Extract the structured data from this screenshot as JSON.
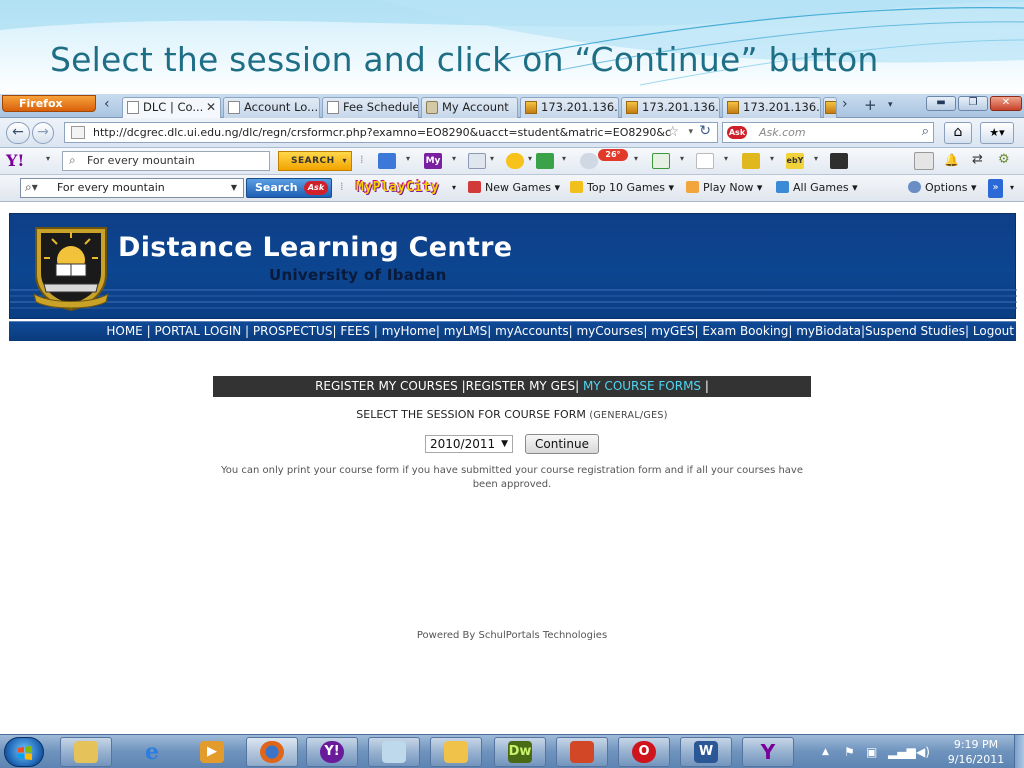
{
  "slide": {
    "title": "Select the session and click on “Continue” button"
  },
  "browser": {
    "app_button": "Firefox",
    "tabs": [
      {
        "label": "DLC | Co...",
        "active": true
      },
      {
        "label": "Account Lo...",
        "active": false
      },
      {
        "label": "Fee Schedule",
        "active": false
      },
      {
        "label": "My Account",
        "active": false
      },
      {
        "label": "173.201.136....",
        "active": false
      },
      {
        "label": "173.201.136....",
        "active": false
      },
      {
        "label": "173.201.136....",
        "active": false
      }
    ],
    "url": "http://dcgrec.dlc.ui.edu.ng/dlc/regn/crsformcr.php?examno=EO8290&uacct=student&matric=EO8290&c",
    "ask_placeholder": "Ask.com",
    "ask_logo": "Ask"
  },
  "yahoo_toolbar": {
    "logo": "Y!",
    "search_value": "For every mountain",
    "search_button": "SEARCH",
    "weather_temp": "26°"
  },
  "ask_toolbar": {
    "search_value": "For every mountain",
    "search_button": "Search",
    "mpc_logo": "MyPlayCity",
    "links": [
      "New Games",
      "Top 10 Games",
      "Play Now",
      "All Games"
    ],
    "options": "Options"
  },
  "site": {
    "title": "Distance Learning Centre",
    "subtitle": "University of Ibadan",
    "nav": [
      "HOME",
      "PORTAL LOGIN",
      "PROSPECTUS",
      "FEES",
      "myHome",
      "myLMS",
      "myAccounts",
      "myCourses",
      "myGES",
      "Exam Booking",
      "myBiodata",
      "Suspend Studies",
      "Logout"
    ],
    "course_tabs": {
      "register_courses": "REGISTER MY COURSES",
      "register_ges": "REGISTER MY GES",
      "course_forms": "MY COURSE FORMS"
    },
    "session_label": "SELECT THE SESSION FOR COURSE FORM",
    "session_label_small": "(GENERAL/GES)",
    "session_value": "2010/2011",
    "continue_label": "Continue",
    "note": "You can only print your course form if you have submitted your course registration form and if all your courses have been approved.",
    "powered_by": "Powered By SchulPortals Technologies"
  },
  "taskbar": {
    "time": "9:19 PM",
    "date": "9/16/2011",
    "apps": [
      "explorer",
      "internet-explorer",
      "media-player",
      "firefox",
      "yahoo-messenger",
      "notepad",
      "outlook",
      "dreamweaver",
      "powerpoint",
      "opera",
      "word",
      "yahoo"
    ],
    "dw_label": "Dw",
    "word_label": "W"
  },
  "colors": {
    "banner": "#0c4590",
    "nav_bar": "#0f4a98",
    "course_bar": "#333333",
    "active_tab_text": "#4fd7f2",
    "slide_title": "#1e6f86"
  }
}
